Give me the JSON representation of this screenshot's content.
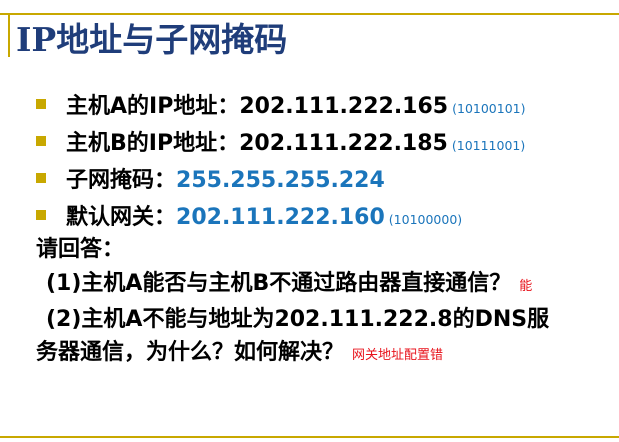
{
  "slide": {
    "title": "IP地址与子网掩码",
    "colors": {
      "title": "#1f3d7a",
      "bullet": "#c8a800",
      "rule": "#c8a800",
      "highlight_blue": "#1b75bb",
      "answer_red": "#e8121b"
    },
    "bullets": [
      {
        "label": "主机A的IP地址：",
        "value": "202.111.222.165",
        "note": "(10100101)"
      },
      {
        "label": "主机B的IP地址：",
        "value": "202.111.222.185",
        "note": "(10111001)"
      },
      {
        "label": "子网掩码：",
        "value": "255.255.255.224",
        "note": ""
      },
      {
        "label": "默认网关：",
        "value": "202.111.222.160",
        "note": "(10100000)"
      }
    ],
    "question_heading": "请回答：",
    "questions": [
      {
        "lines": [
          "(1)主机A能否与主机B不通过路由器直接通信？"
        ],
        "answer": "能"
      },
      {
        "lines": [
          "(2)主机A不能与地址为202.111.222.8的DNS服",
          "务器通信，为什么？如何解决？"
        ],
        "answer": "网关地址配置错"
      }
    ]
  }
}
